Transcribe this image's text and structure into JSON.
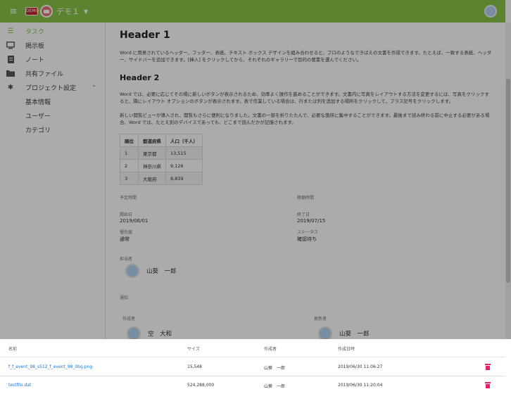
{
  "topbar": {
    "app_title": "デモ１",
    "logo_text": "DEMO"
  },
  "sidebar": {
    "items": [
      {
        "label": "タスク",
        "icon": "list-icon"
      },
      {
        "label": "掲示板",
        "icon": "monitor-icon"
      },
      {
        "label": "ノート",
        "icon": "note-icon"
      },
      {
        "label": "共有ファイル",
        "icon": "folder-icon"
      },
      {
        "label": "プロジェクト設定",
        "icon": "gear-icon"
      }
    ],
    "sub_items": [
      "基本情報",
      "ユーザー",
      "カテゴリ"
    ]
  },
  "content": {
    "header1": "Header 1",
    "para1": "Word に用意されているヘッダー、フッター、表紙、テキスト ボックス デザインを組み合わせると、プロのようなできばえの文書を作成できます。たとえば、一致する表紙、ヘッダー、サイドバーを追加できます。[挿入] をクリックしてから、それぞれのギャラリーで目的の要素を選んでください。",
    "header2": "Header 2",
    "para2": "Word では、必要に応じてその場に新しいボタンが表示されるため、効率よく操作を進めることができます。文書内に写真をレイアウトする方法を変更するには、写真をクリックすると、隣にレイアウト オプションのボタンが表示されます。表で作業している場合は、行または列を追加する場所をクリックして、プラス記号をクリックします。",
    "para3": "新しい閲覧ビューが導入され、閲覧もさらに便利になりました。文書の一部を折りたたんで、必要な箇所に集中することができます。最後まで読み終わる前に中止する必要がある場合、Word では、たとえ別のデバイスであっても、どこまで読んだかが記憶されます。",
    "table": {
      "headers": [
        "順位",
        "都道府県",
        "人口（千人）"
      ],
      "rows": [
        [
          "1",
          "東京都",
          "13,515"
        ],
        [
          "2",
          "神奈川県",
          "9,126"
        ],
        [
          "3",
          "大阪府",
          "8,839"
        ]
      ]
    },
    "meta": {
      "planned_label": "予定時間",
      "actual_label": "稼働時間",
      "start_label": "開始日",
      "start_value": "2019/06/01",
      "end_label": "終了日",
      "end_value": "2019/07/15",
      "priority_label": "優先度",
      "priority_value": "通常",
      "status_label": "ステータス",
      "status_value": "確認待ち",
      "assignee_label": "担当者",
      "assignee_name": "山葵　一郎",
      "notify_label": "通知",
      "creator_label": "作成者",
      "creator_name": "空　大和",
      "updater_label": "更新者",
      "updater_name": "山葵　一郎"
    }
  },
  "files": {
    "headers": {
      "name": "名前",
      "size": "サイズ",
      "author": "作成者",
      "date": "作成日時"
    },
    "rows": [
      {
        "name": "f_f_event_98_s512_f_event_98_0bg.png",
        "size": "15,548",
        "author": "山葵　一郎",
        "date": "2019/06/30 11:06:27"
      },
      {
        "name": "testfile.dat",
        "size": "524,288,000",
        "author": "山葵　一郎",
        "date": "2019/06/30 11:20:04"
      }
    ]
  },
  "colors": {
    "accent": "#8bc34a",
    "link": "#1976d2",
    "delete": "#e91e63"
  }
}
